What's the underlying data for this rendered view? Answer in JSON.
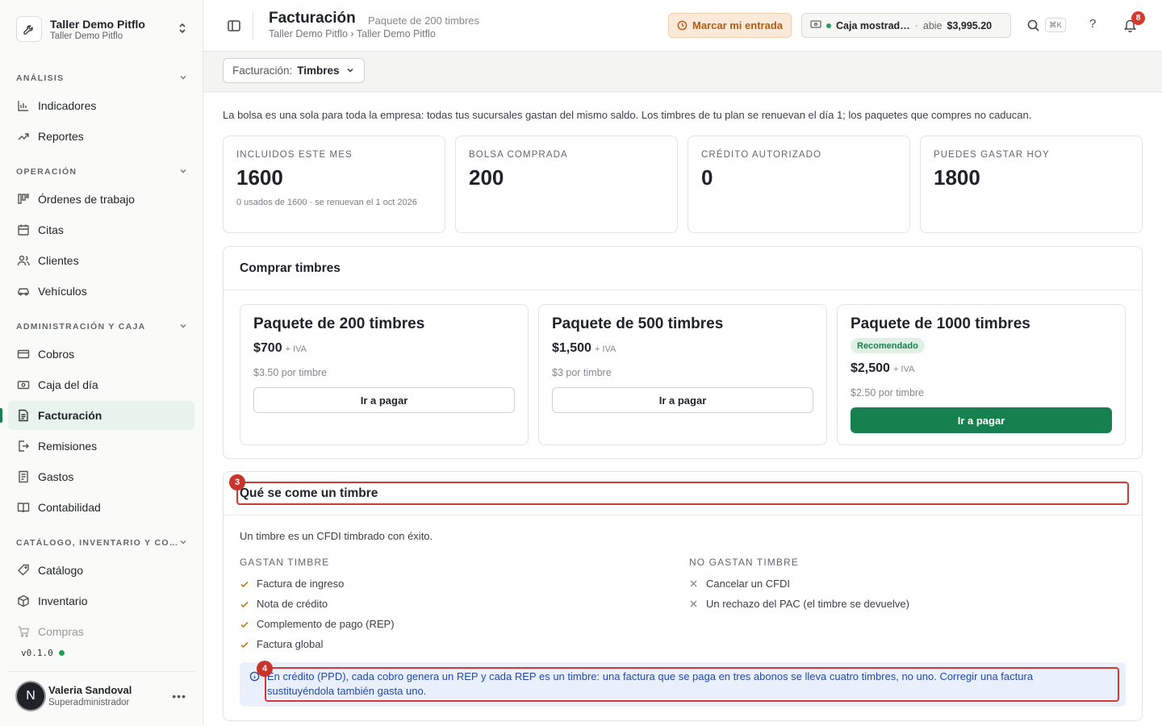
{
  "org": {
    "name": "Taller Demo Pitflo",
    "subtitle": "Taller Demo Pitflo"
  },
  "sidebar": {
    "sections": [
      {
        "title": "ANÁLISIS",
        "items": [
          {
            "label": "Indicadores",
            "icon": "bar-chart-icon"
          },
          {
            "label": "Reportes",
            "icon": "trend-icon"
          }
        ]
      },
      {
        "title": "OPERACIÓN",
        "items": [
          {
            "label": "Órdenes de trabajo",
            "icon": "kanban-icon"
          },
          {
            "label": "Citas",
            "icon": "calendar-icon"
          },
          {
            "label": "Clientes",
            "icon": "users-icon"
          },
          {
            "label": "Vehículos",
            "icon": "car-icon"
          }
        ]
      },
      {
        "title": "ADMINISTRACIÓN Y CAJA",
        "items": [
          {
            "label": "Cobros",
            "icon": "card-icon"
          },
          {
            "label": "Caja del día",
            "icon": "cash-icon"
          },
          {
            "label": "Facturación",
            "icon": "invoice-icon",
            "active": true
          },
          {
            "label": "Remisiones",
            "icon": "export-icon"
          },
          {
            "label": "Gastos",
            "icon": "receipt-icon"
          },
          {
            "label": "Contabilidad",
            "icon": "book-icon"
          }
        ]
      },
      {
        "title": "CATÁLOGO, INVENTARIO Y CO…",
        "items": [
          {
            "label": "Catálogo",
            "icon": "tag-icon"
          },
          {
            "label": "Inventario",
            "icon": "box-icon"
          },
          {
            "label": "Compras",
            "icon": "cart-icon"
          }
        ]
      }
    ],
    "version": "v0.1.0"
  },
  "user": {
    "initial": "N",
    "name": "Valeria Sandoval",
    "role": "Superadministrador"
  },
  "header": {
    "title": "Facturación",
    "subtitle": "Paquete de 200 timbres",
    "breadcrumb": "Taller Demo Pitflo › Taller Demo Pitflo",
    "entry_button": "Marcar mi entrada",
    "register": {
      "name": "Caja mostrad…",
      "separator": "·",
      "status": "abie",
      "amount": "$3,995.20"
    },
    "shortcut": "⌘K",
    "help": "?",
    "notifications": "8"
  },
  "toolbar": {
    "selector_label": "Facturación:",
    "selector_value": "Timbres"
  },
  "intro": "La bolsa es una sola para toda la empresa: todas tus sucursales gastan del mismo saldo. Los timbres de tu plan se renuevan el día 1; los paquetes que compres no caducan.",
  "stats": [
    {
      "label": "INCLUIDOS ESTE MES",
      "value": "1600",
      "note": "0 usados de 1600 · se renuevan el 1 oct 2026"
    },
    {
      "label": "BOLSA COMPRADA",
      "value": "200",
      "note": ""
    },
    {
      "label": "CRÉDITO AUTORIZADO",
      "value": "0",
      "note": ""
    },
    {
      "label": "PUEDES GASTAR HOY",
      "value": "1800",
      "note": ""
    }
  ],
  "buy": {
    "title": "Comprar timbres",
    "packages": [
      {
        "name": "Paquete de 200 timbres",
        "price": "$700",
        "tax": "+ IVA",
        "unit": "$3.50 por timbre",
        "button": "Ir a pagar",
        "badge": ""
      },
      {
        "name": "Paquete de 500 timbres",
        "price": "$1,500",
        "tax": "+ IVA",
        "unit": "$3 por timbre",
        "button": "Ir a pagar",
        "badge": ""
      },
      {
        "name": "Paquete de 1000 timbres",
        "price": "$2,500",
        "tax": "+ IVA",
        "unit": "$2.50 por timbre",
        "button": "Ir a pagar",
        "badge": "Recomendado"
      }
    ]
  },
  "explain": {
    "title": "Qué se come un timbre",
    "lead": "Un timbre es un CFDI timbrado con éxito.",
    "spend_title": "GASTAN TIMBRE",
    "spend": [
      "Factura de ingreso",
      "Nota de crédito",
      "Complemento de pago (REP)",
      "Factura global"
    ],
    "nospend_title": "NO GASTAN TIMBRE",
    "nospend": [
      "Cancelar un CFDI",
      "Un rechazo del PAC (el timbre se devuelve)"
    ],
    "note": "En crédito (PPD), cada cobro genera un REP y cada REP es un timbre: una factura que se paga en tres abonos se lleva cuatro timbres, no uno. Corregir una factura sustituyéndola también gasta uno."
  },
  "annotations": [
    "3",
    "4"
  ],
  "colors": {
    "accent": "#17804f",
    "warning_bg": "#fbe9d9",
    "annotation": "#d23a31",
    "info_text": "#2449a8"
  }
}
